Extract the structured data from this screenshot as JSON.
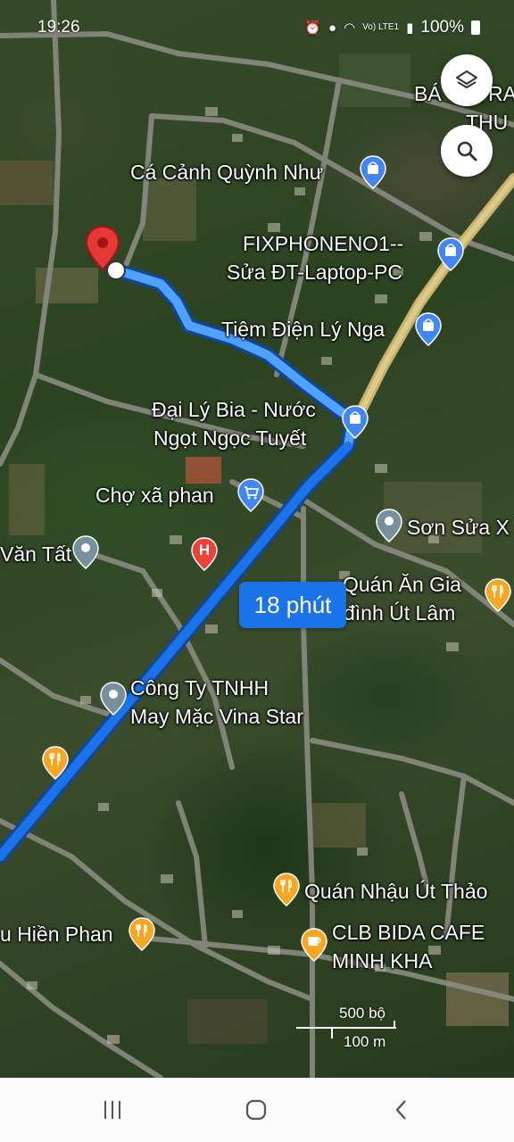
{
  "status_bar": {
    "time": "19:26",
    "network": "Vo) LTE1",
    "battery": "100%"
  },
  "map": {
    "route_duration": "18 phút",
    "route_color": "#1a73e8",
    "places": [
      {
        "name": "Cá Cảnh Quỳnh Như",
        "icon": "shopping-bag-icon"
      },
      {
        "name": "FIXPHONENO1--",
        "name2": "Sửa ĐT-Laptop-PC",
        "icon": "shopping-bag-icon"
      },
      {
        "name": "Tiệm Điện Lý Nga",
        "icon": "shopping-bag-icon"
      },
      {
        "name": "Đại Lý Bia - Nước",
        "name2": "Ngọt Ngọc Tuyết",
        "icon": "shopping-bag-icon"
      },
      {
        "name": "Chợ xã phan",
        "icon": "shopping-cart-icon"
      },
      {
        "name": "Sơn Sửa X",
        "icon": "place-icon"
      },
      {
        "name": "Văn Tất",
        "icon": "place-icon"
      },
      {
        "name": "Quán Ăn Gia",
        "name2": "đình Út Lâm",
        "icon": "restaurant-icon"
      },
      {
        "name": "Công Ty TNHH",
        "name2": "May Mặc Vina Star",
        "icon": "place-icon"
      },
      {
        "name": "Quán Nhậu Út Thảo",
        "icon": "restaurant-icon"
      },
      {
        "name": "u Hiền Phan",
        "icon": "restaurant-icon"
      },
      {
        "name": "CLB BIDA CAFE",
        "name2": "MINH KHA",
        "icon": "coffee-icon"
      }
    ],
    "edge_labels": [
      "BÁ",
      "TRA",
      "THU"
    ],
    "hospital_label": "H",
    "scale": {
      "imperial": "500 bộ",
      "metric": "100 m"
    }
  },
  "controls": {
    "layers_icon": "layers-icon",
    "search_icon": "search-icon"
  },
  "nav": {
    "recents_icon": "recents-icon",
    "home_icon": "home-icon",
    "back_icon": "back-icon"
  }
}
